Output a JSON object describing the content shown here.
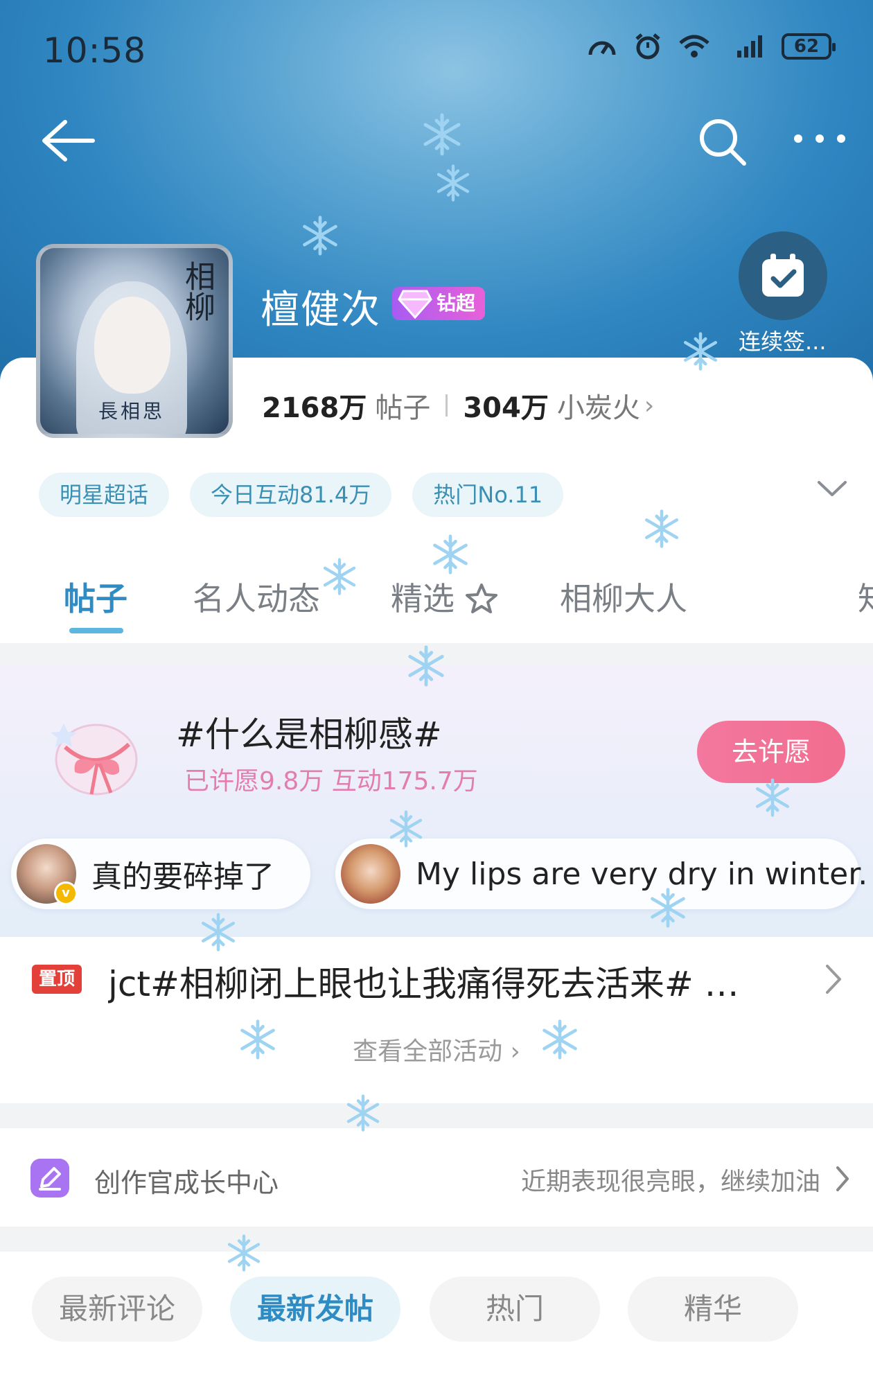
{
  "status_bar": {
    "time": "10:58",
    "battery": "62"
  },
  "header": {
    "name": "檀健次",
    "badge_label": "钻超",
    "checkin_label": "连续签..."
  },
  "avatar": {
    "poster_title": "相柳",
    "poster_sub": "長相思"
  },
  "stats": {
    "posts_count": "2168万",
    "posts_unit": "帖子",
    "fire_count": "304万",
    "fire_unit": "小炭火"
  },
  "tags": [
    "明星超话",
    "今日互动81.4万",
    "热门No.11"
  ],
  "tabs": [
    "帖子",
    "名人动态",
    "精选",
    "相柳大人",
    "知"
  ],
  "wish": {
    "title": "#什么是相柳感#",
    "subtitle": "已许愿9.8万 互动175.7万",
    "button": "去许愿",
    "bubbles": [
      "真的要碎掉了",
      "My lips are very dry in winter."
    ]
  },
  "pinned": {
    "tag": "置顶",
    "text": "jct#相柳闭上眼也让我痛得死去活来#  …",
    "view_all": "查看全部活动 ›"
  },
  "growth": {
    "title": "创作官成长中心",
    "hint": "近期表现很亮眼，继续加油"
  },
  "sort_tabs": [
    "最新评论",
    "最新发帖",
    "热门",
    "精华"
  ],
  "colors": {
    "accent": "#2f8bc4",
    "wish_button": "#f3779e",
    "pin_tag": "#e3403a",
    "badge": "#b85ef0"
  }
}
